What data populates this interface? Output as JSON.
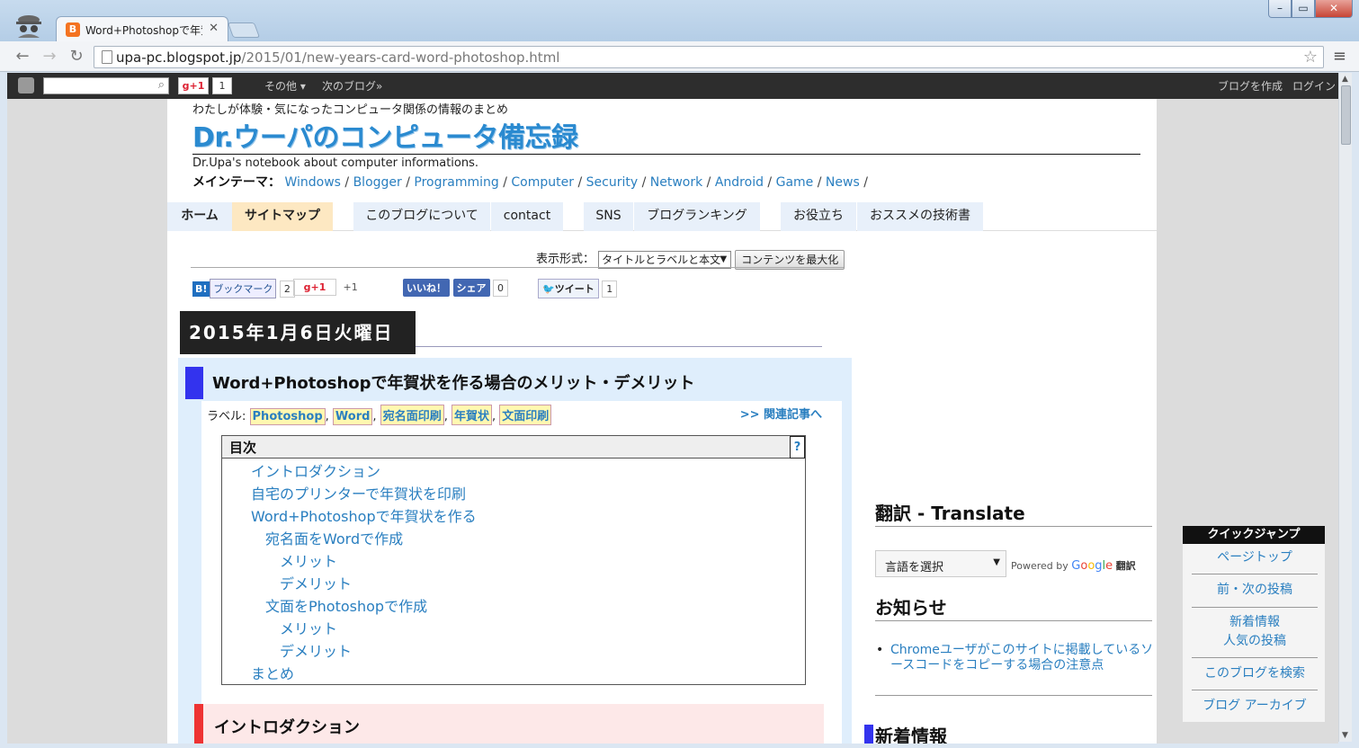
{
  "browser": {
    "tab_title": "Word+Photoshopで年賀",
    "url_host": "upa-pc.blogspot.jp",
    "url_path": "/2015/01/new-years-card-word-photoshop.html"
  },
  "bloggerbar": {
    "gplus": "g+1",
    "gplus_count": "1",
    "more": "その他 ▾",
    "next_blog": "次のブログ»",
    "create_blog": "ブログを作成",
    "login": "ログイン"
  },
  "header": {
    "tagline": "わたしが体験・気になったコンピュータ関係の情報のまとめ",
    "title": "Dr.ウーパのコンピュータ備忘録",
    "description": "Dr.Upa's notebook about computer informations.",
    "themes_label": "メインテーマ：",
    "themes": [
      "Windows",
      "Blogger",
      "Programming",
      "Computer",
      "Security",
      "Network",
      "Android",
      "Game",
      "News"
    ]
  },
  "nav": {
    "home": "ホーム",
    "sitemap": "サイトマップ",
    "about": "このブログについて",
    "contact": "contact",
    "sns": "SNS",
    "ranking": "ブログランキング",
    "useful": "お役立ち",
    "books": "おススメの技術書"
  },
  "display": {
    "label": "表示形式：",
    "selected": "タイトルとラベルと本文",
    "maximize": "コンテンツを最大化"
  },
  "social": {
    "hatena": "ブックマーク",
    "hatena_count": "2",
    "gplus": "g+1",
    "gplus_count": "+1",
    "like": "いいね！",
    "share": "シェア",
    "share_count": "0",
    "tweet": "ツイート",
    "tweet_count": "1"
  },
  "post": {
    "date": "2015年1月6日火曜日",
    "title": "Word+Photoshopで年賀状を作る場合のメリット・デメリット",
    "labels_prefix": "ラベル:",
    "labels": [
      "Photoshop",
      "Word",
      "宛名面印刷",
      "年賀状",
      "文面印刷"
    ],
    "related": ">> 関連記事へ",
    "toc_title": "目次",
    "toc_help": "?",
    "toc": [
      "イントロダクション",
      "自宅のプリンターで年賀状を印刷",
      "Word+Photoshopで年賀状を作る",
      "宛名面をWordで作成",
      "メリット",
      "デメリット",
      "文面をPhotoshopで作成",
      "メリット",
      "デメリット",
      "まとめ"
    ],
    "intro_heading": "イントロダクション"
  },
  "sidebar": {
    "translate_title": "翻訳 - Translate",
    "lang_select": "言語を選択",
    "powered_by": "Powered by",
    "google": "Google",
    "translate_word": "翻訳",
    "notice_title": "お知らせ",
    "notice_item": "Chromeユーザがこのサイトに掲載しているソースコードをコピーする場合の注意点",
    "new_title": "新着情報"
  },
  "quickjump": {
    "title": "クイックジャンプ",
    "page_top": "ページトップ",
    "prev_next": "前・次の投稿",
    "new_info": "新着情報",
    "popular": "人気の投稿",
    "search": "このブログを検索",
    "archive": "ブログ アーカイブ"
  }
}
